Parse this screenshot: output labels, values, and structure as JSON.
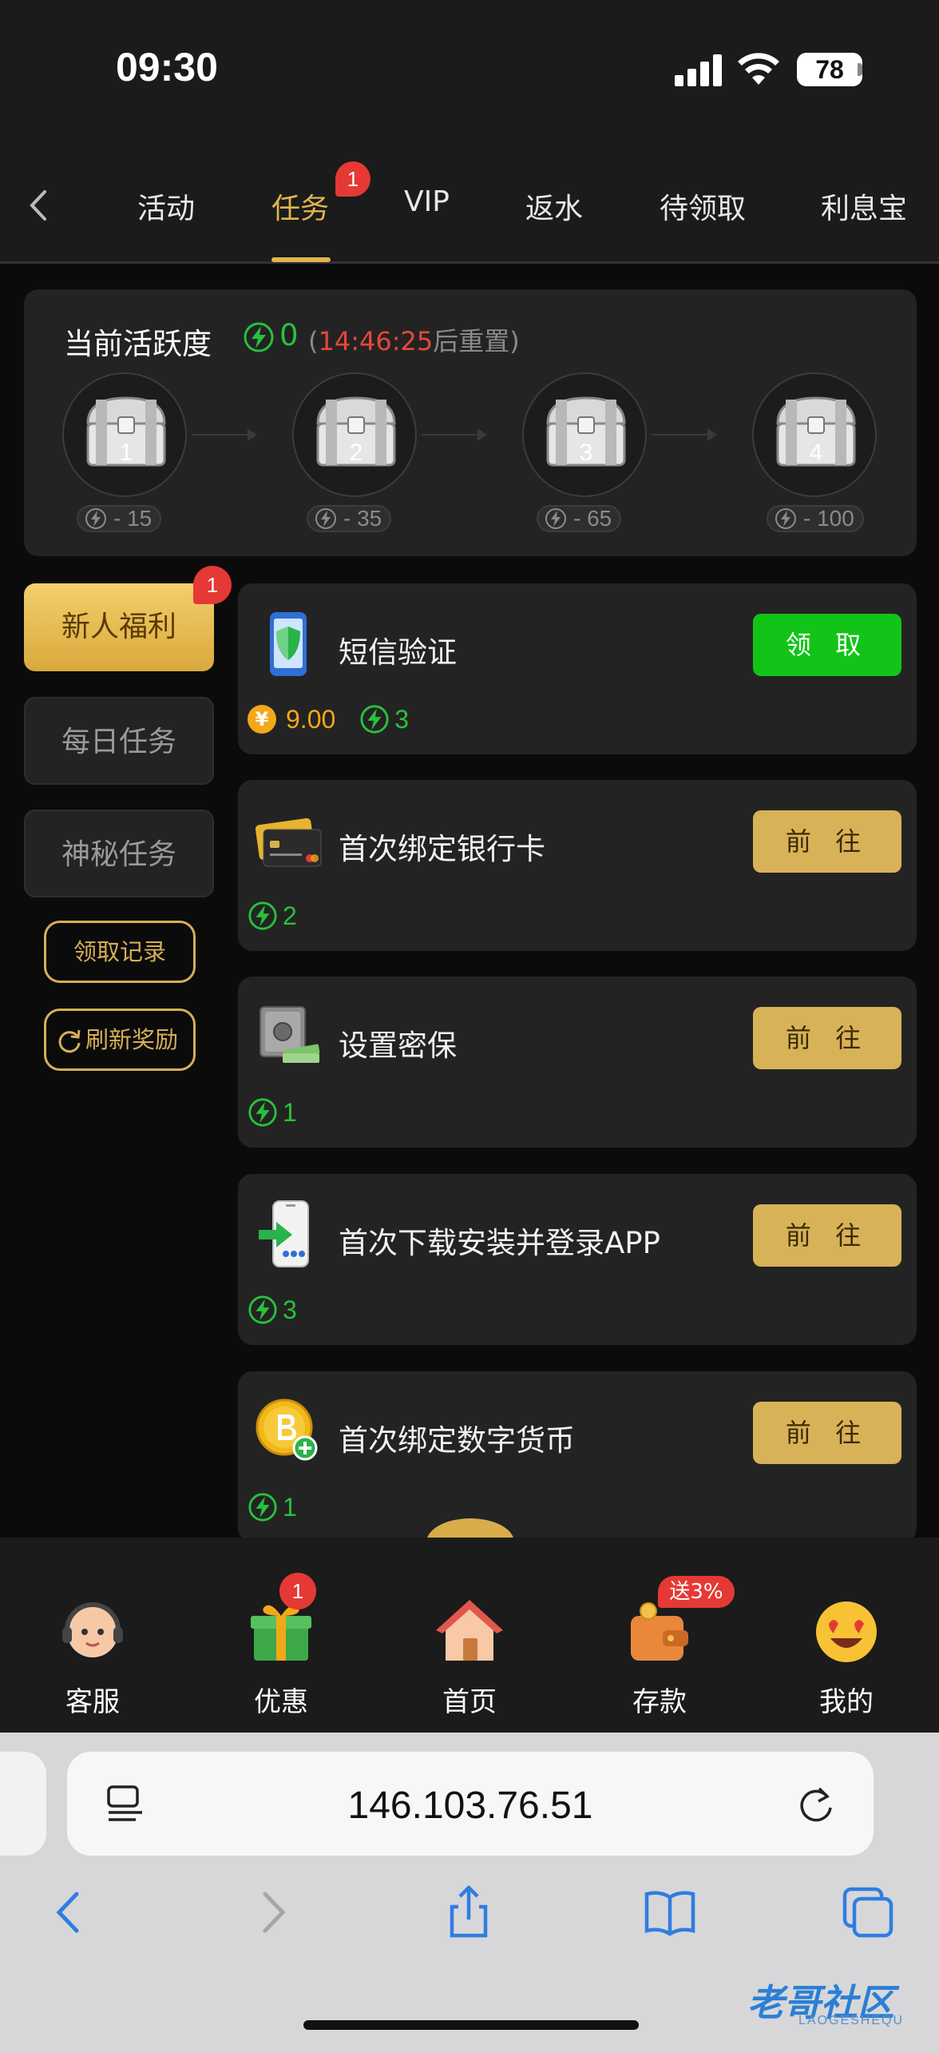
{
  "status_bar": {
    "time": "09:30",
    "battery": "78"
  },
  "top_nav": {
    "tabs": [
      {
        "label": "活动"
      },
      {
        "label": "任务",
        "active": true,
        "badge": "1"
      },
      {
        "label": "VIP"
      },
      {
        "label": "返水"
      },
      {
        "label": "待领取"
      },
      {
        "label": "利息宝"
      }
    ]
  },
  "activity": {
    "title": "当前活跃度",
    "value": "0",
    "paren_open": "(",
    "timer": "14:46:25",
    "reset_suffix": "后重置)",
    "chests": [
      {
        "number": "1",
        "cost": "- 15"
      },
      {
        "number": "2",
        "cost": "- 35"
      },
      {
        "number": "3",
        "cost": "- 65"
      },
      {
        "number": "4",
        "cost": "- 100"
      }
    ]
  },
  "side_menu": {
    "items": [
      {
        "label": "新人福利",
        "active": true,
        "badge": "1"
      },
      {
        "label": "每日任务"
      },
      {
        "label": "神秘任务"
      }
    ],
    "records_button": "领取记录",
    "refresh_button": "刷新奖励"
  },
  "tasks": [
    {
      "title": "短信验证",
      "button": "领 取",
      "money": "9.00",
      "coin_symbol": "¥",
      "energy": "3",
      "icon": "shield-phone-icon"
    },
    {
      "title": "首次绑定银行卡",
      "button": "前 往",
      "energy": "2",
      "icon": "bank-card-icon"
    },
    {
      "title": "设置密保",
      "button": "前 往",
      "energy": "1",
      "icon": "safe-icon"
    },
    {
      "title": "首次下载安装并登录APP",
      "button": "前 往",
      "energy": "3",
      "icon": "app-download-icon"
    },
    {
      "title": "首次绑定数字货币",
      "button": "前 往",
      "energy": "1",
      "icon": "bitcoin-icon"
    }
  ],
  "bottom_tabs": [
    {
      "label": "客服",
      "icon": "customer-service-icon"
    },
    {
      "label": "优惠",
      "icon": "gift-icon",
      "badge": "1"
    },
    {
      "label": "首页",
      "icon": "house-icon"
    },
    {
      "label": "存款",
      "icon": "wallet-icon",
      "tag": "送3%"
    },
    {
      "label": "我的",
      "icon": "smiley-icon"
    }
  ],
  "browser": {
    "url": "146.103.76.51"
  },
  "watermark": {
    "text": "老哥社区",
    "sub": "LAOGESHEQU"
  },
  "colors": {
    "gold": "#e0b54c",
    "green": "#12c417",
    "energy_green": "#27c23c",
    "red": "#e53935",
    "background": "#0b0b0b",
    "card": "#232323"
  }
}
